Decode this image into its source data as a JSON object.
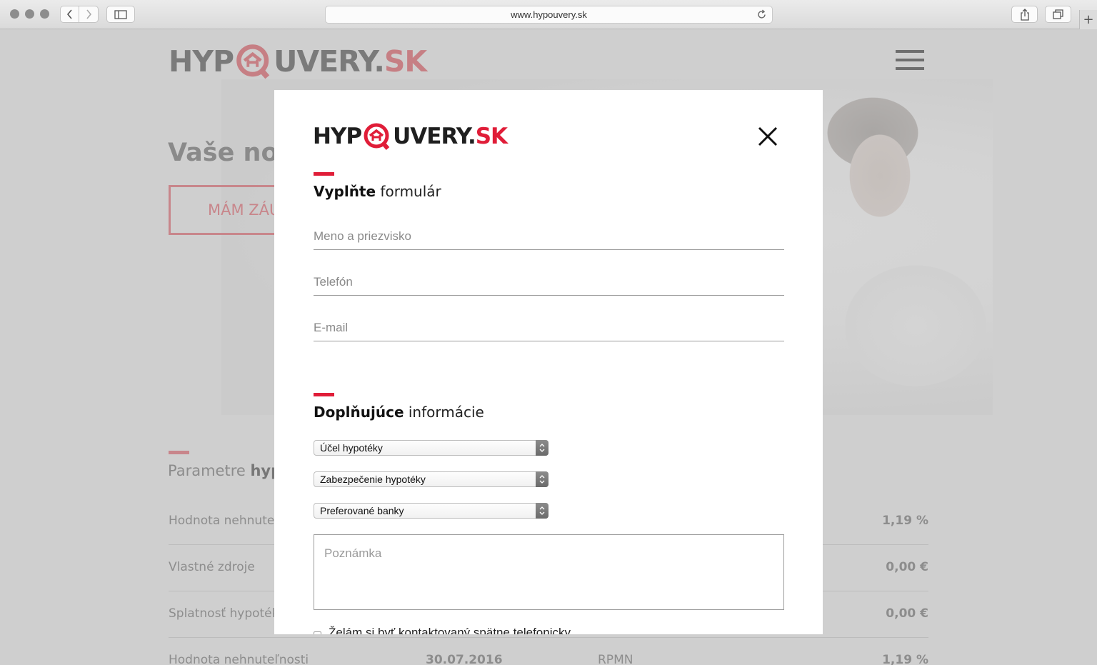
{
  "browser": {
    "url": "www.hypouvery.sk"
  },
  "background": {
    "logo": {
      "left": "HYP",
      "right": "UVERY.",
      "suffix": "SK"
    },
    "hero_heading": "Vaše nov",
    "cta_label": "MÁM ZÁU",
    "params_title_plain": "Parametre ",
    "params_title_bold": "hyp",
    "rows": [
      {
        "label": "Hodnota nehnuteľn",
        "value": "1,19 %"
      },
      {
        "label": "Vlastné zdroje",
        "value": "0,00 €"
      },
      {
        "label": "Splatnosť hypotéky",
        "value": "0,00 €"
      }
    ],
    "last_row": {
      "label": "Hodnota nehnuteľnosti",
      "date": "30.07.2016",
      "metric": "RPMN",
      "value": "1,19 %"
    }
  },
  "modal": {
    "logo": {
      "left": "HYP",
      "right": "UVERY.",
      "suffix": "SK"
    },
    "section1": {
      "bold": "Vyplňte",
      "rest": " formulár"
    },
    "fields": {
      "name_placeholder": "Meno a priezvisko",
      "phone_placeholder": "Telefón",
      "email_placeholder": "E-mail"
    },
    "section2": {
      "bold": "Doplňujúce",
      "rest": " informácie"
    },
    "selects": [
      "Účel hypotéky",
      "Zabezpečenie hypotéky",
      "Preferované banky"
    ],
    "note_placeholder": "Poznámka",
    "callback_label": "Želám si byť kontaktovaný spätne telefonicky"
  },
  "colors": {
    "brand_red": "#e01d38",
    "overlay_gray": "#cfcfcf"
  }
}
